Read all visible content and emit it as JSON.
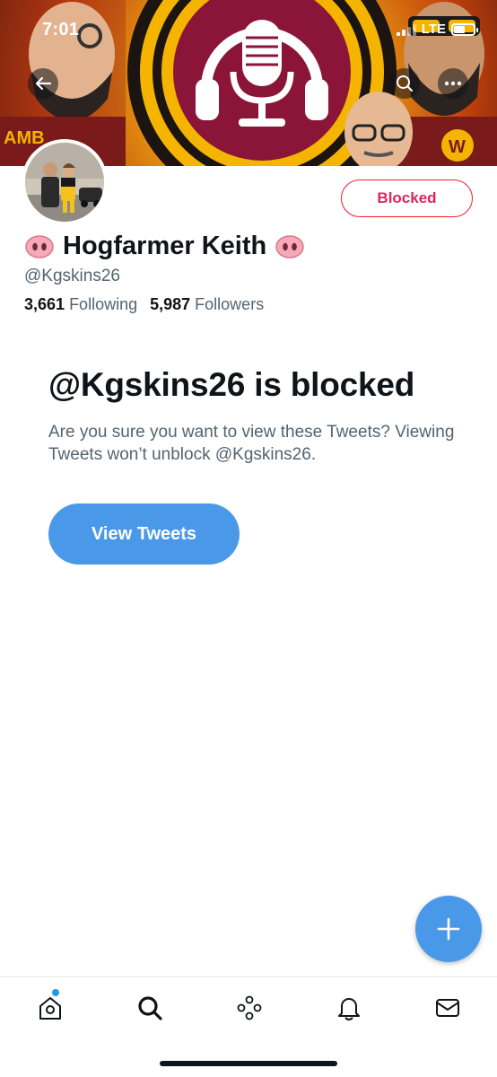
{
  "status_bar": {
    "time": "7:01",
    "network": "LTE"
  },
  "banner": {
    "icons": [
      "back-arrow-icon",
      "search-icon",
      "more-icon"
    ],
    "image_description_note": ""
  },
  "profile": {
    "display_name": "Hogfarmer Keith",
    "handle": "@Kgskins26",
    "following_count": "3,661",
    "following_label": "Following",
    "followers_count": "5,987",
    "followers_label": "Followers",
    "blocked_button_label": "Blocked"
  },
  "blocked_notice": {
    "title": "@Kgskins26 is blocked",
    "description": "Are you sure you want to view these Tweets? Viewing Tweets won’t unblock @Kgskins26.",
    "view_button_label": "View Tweets"
  },
  "tab_bar": {
    "items": [
      "home-icon",
      "search-icon",
      "spaces-icon",
      "notifications-icon",
      "messages-icon"
    ],
    "home_has_notification_dot": true
  },
  "colors": {
    "accent": "#4a99e9",
    "blocked_red": "#e0245e",
    "text_primary": "#0f1419",
    "text_secondary": "#536471"
  }
}
